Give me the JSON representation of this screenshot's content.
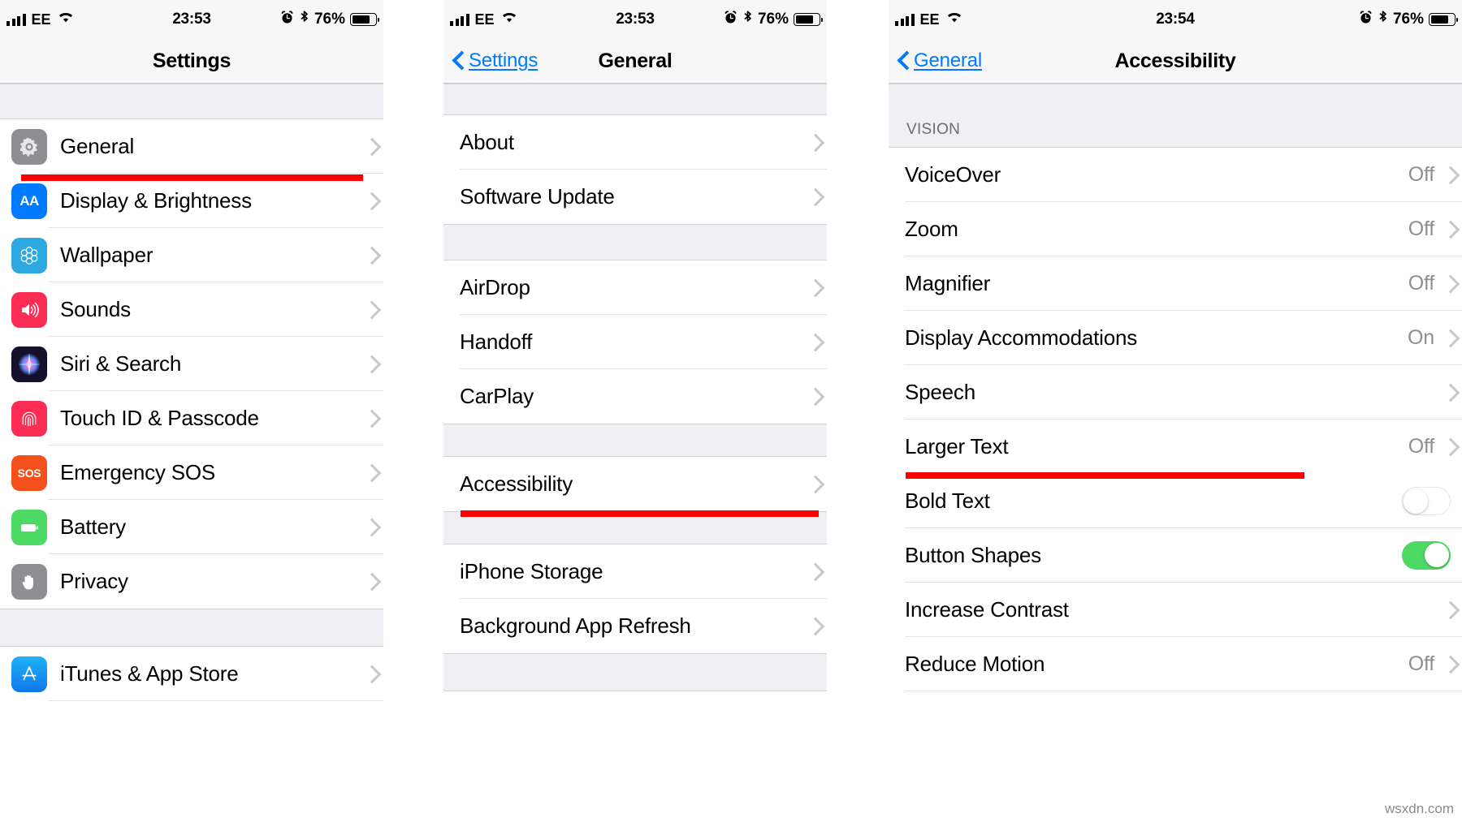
{
  "watermark": "wsxdn.com",
  "accent": {
    "link": "#007aff",
    "highlight": "#ff0000",
    "toggle_on": "#4cd964",
    "value_gray": "#8e8e93"
  },
  "panels": [
    {
      "status": {
        "carrier": "EE",
        "time": "23:53",
        "battery_percent": "76%"
      },
      "nav": {
        "title": "Settings",
        "back": null
      },
      "rows": [
        {
          "label": "General",
          "icon": "gear-icon",
          "icon_bg": "#8e8e93",
          "highlighted": true
        },
        {
          "label": "Display & Brightness",
          "icon": "aa-text-icon",
          "icon_bg": "#007aff"
        },
        {
          "label": "Wallpaper",
          "icon": "flower-icon",
          "icon_bg": "#2ca9e1"
        },
        {
          "label": "Sounds",
          "icon": "speaker-icon",
          "icon_bg": "#fb2d54"
        },
        {
          "label": "Siri & Search",
          "icon": "siri-icon",
          "icon_bg": "#1b1433"
        },
        {
          "label": "Touch ID & Passcode",
          "icon": "fingerprint-icon",
          "icon_bg": "#fb2d54"
        },
        {
          "label": "Emergency SOS",
          "icon": "sos-icon",
          "icon_bg": "#f3501d"
        },
        {
          "label": "Battery",
          "icon": "battery-icon",
          "icon_bg": "#4cd964"
        },
        {
          "label": "Privacy",
          "icon": "hand-icon",
          "icon_bg": "#8e8e93"
        },
        {
          "gap": true
        },
        {
          "label": "iTunes & App Store",
          "icon": "appstore-icon",
          "icon_bg": "#1d9bf5"
        }
      ]
    },
    {
      "status": {
        "carrier": "EE",
        "time": "23:53",
        "battery_percent": "76%"
      },
      "nav": {
        "title": "General",
        "back": "Settings"
      },
      "rows": [
        {
          "gap": true
        },
        {
          "label": "About"
        },
        {
          "label": "Software Update"
        },
        {
          "gap": true
        },
        {
          "label": "AirDrop"
        },
        {
          "label": "Handoff"
        },
        {
          "label": "CarPlay"
        },
        {
          "gap": true
        },
        {
          "label": "Accessibility",
          "highlighted": true
        },
        {
          "gap": true
        },
        {
          "label": "iPhone Storage"
        },
        {
          "label": "Background App Refresh"
        },
        {
          "gap": true
        }
      ]
    },
    {
      "status": {
        "carrier": "EE",
        "time": "23:54",
        "battery_percent": "76%"
      },
      "nav": {
        "title": "Accessibility",
        "back": "General"
      },
      "section_header": "VISION",
      "rows": [
        {
          "label": "VoiceOver",
          "value": "Off",
          "chevron": true
        },
        {
          "label": "Zoom",
          "value": "Off",
          "chevron": true
        },
        {
          "label": "Magnifier",
          "value": "Off",
          "chevron": true
        },
        {
          "label": "Display Accommodations",
          "value": "On",
          "chevron": true
        },
        {
          "label": "Speech",
          "value": "",
          "chevron": true
        },
        {
          "label": "Larger Text",
          "value": "Off",
          "chevron": true,
          "highlighted": true
        },
        {
          "label": "Bold Text",
          "toggle": "off"
        },
        {
          "label": "Button Shapes",
          "toggle": "on"
        },
        {
          "label": "Increase Contrast",
          "value": "",
          "chevron": true
        },
        {
          "label": "Reduce Motion",
          "value": "Off",
          "chevron": true
        }
      ]
    }
  ]
}
